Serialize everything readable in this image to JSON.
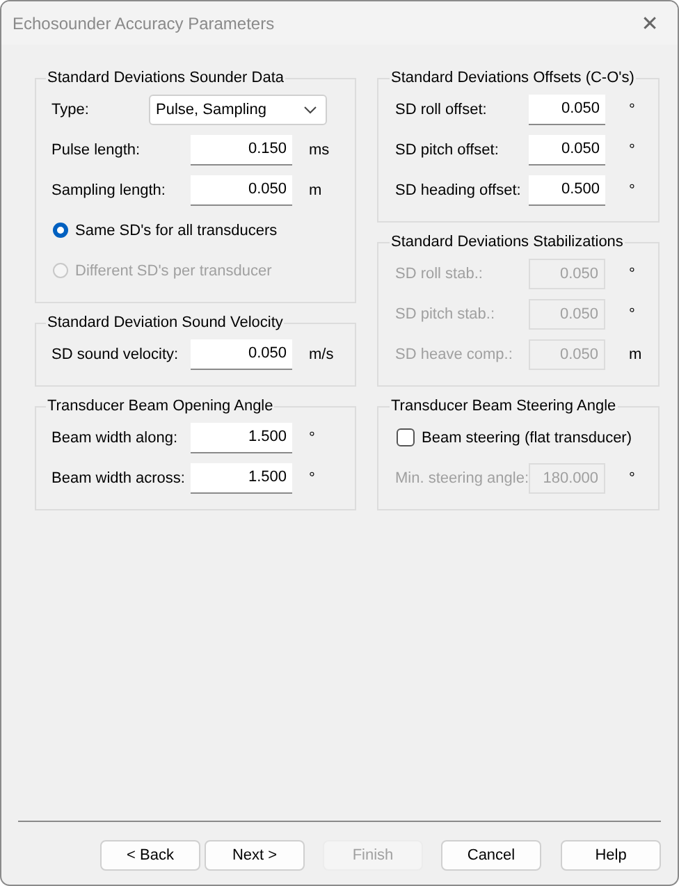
{
  "window": {
    "title": "Echosounder Accuracy Parameters",
    "close": "✕"
  },
  "columns": [
    {
      "groups": [
        {
          "title": "Standard Deviations Sounder Data",
          "rows": [
            {
              "kind": "select",
              "label": "Type:",
              "value": "Pulse, Sampling",
              "disabled": false
            },
            {
              "kind": "field",
              "label": "Pulse length:",
              "value": "0.150",
              "unit": "ms",
              "disabled": false
            },
            {
              "kind": "field",
              "label": "Sampling length:",
              "value": "0.050",
              "unit": "m",
              "disabled": false
            },
            {
              "kind": "radio",
              "label": "Same SD's for all transducers",
              "selected": true,
              "disabled": false
            },
            {
              "kind": "radio",
              "label": "Different SD's per transducer",
              "selected": false,
              "disabled": true
            }
          ]
        },
        {
          "title": "Standard Deviation Sound Velocity",
          "rows": [
            {
              "kind": "field",
              "label": "SD sound velocity:",
              "value": "0.050",
              "unit": "m/s",
              "disabled": false
            }
          ]
        },
        {
          "title": "Transducer Beam Opening Angle",
          "rows": [
            {
              "kind": "field",
              "label": "Beam width along:",
              "value": "1.500",
              "unit": "°",
              "disabled": false
            },
            {
              "kind": "field",
              "label": "Beam width across:",
              "value": "1.500",
              "unit": "°",
              "disabled": false
            }
          ]
        }
      ]
    },
    {
      "groups": [
        {
          "title": "Standard Deviations Offsets (C-O's)",
          "rows": [
            {
              "kind": "field",
              "label": "SD roll offset:",
              "value": "0.050",
              "unit": "°",
              "disabled": false
            },
            {
              "kind": "field",
              "label": "SD pitch offset:",
              "value": "0.050",
              "unit": "°",
              "disabled": false
            },
            {
              "kind": "field",
              "label": "SD heading offset:",
              "value": "0.500",
              "unit": "°",
              "disabled": false
            }
          ]
        },
        {
          "title": "Standard Deviations Stabilizations",
          "rows": [
            {
              "kind": "field",
              "label": "SD roll stab.:",
              "value": "0.050",
              "unit": "°",
              "disabled": true
            },
            {
              "kind": "field",
              "label": "SD pitch stab.:",
              "value": "0.050",
              "unit": "°",
              "disabled": true
            },
            {
              "kind": "field",
              "label": "SD heave comp.:",
              "value": "0.050",
              "unit": "m",
              "disabled": true
            }
          ]
        },
        {
          "title": "Transducer Beam Steering Angle",
          "rows": [
            {
              "kind": "checkbox",
              "label": "Beam steering (flat transducer)",
              "checked": false,
              "disabled": false
            },
            {
              "kind": "field",
              "label": "Min. steering angle:",
              "value": "180.000",
              "unit": "°",
              "disabled": true
            }
          ]
        }
      ]
    }
  ],
  "buttons": [
    {
      "label": "< Back",
      "disabled": false
    },
    {
      "label": "Next >",
      "disabled": false
    },
    {
      "label": "Finish",
      "disabled": true
    },
    {
      "label": "Cancel",
      "disabled": false
    },
    {
      "label": "Help",
      "disabled": false
    }
  ]
}
